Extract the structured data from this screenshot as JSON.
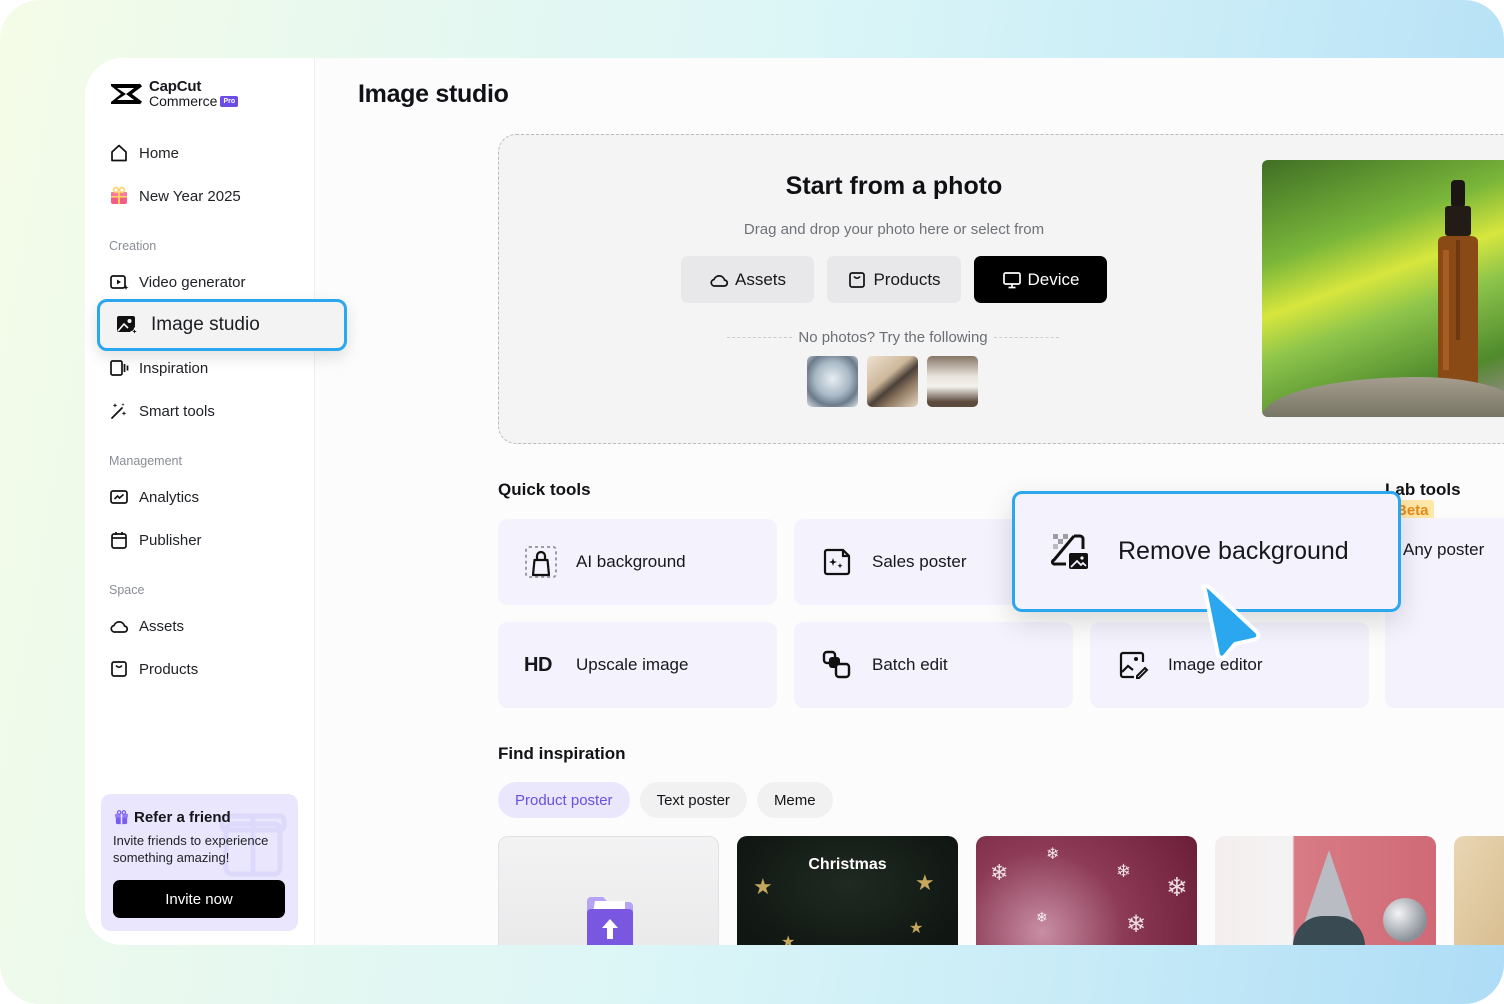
{
  "brand": {
    "name_top": "CapCut",
    "name_bottom": "Commerce",
    "badge": "Pro"
  },
  "sidebar": {
    "top_items": [
      {
        "label": "Home",
        "icon": "home-icon"
      },
      {
        "label": "New Year 2025",
        "icon": "gift-icon"
      }
    ],
    "sections": [
      {
        "label": "Creation",
        "items": [
          {
            "label": "Video generator",
            "icon": "video-sparkle-icon"
          },
          {
            "label": "Image studio",
            "icon": "image-sparkle-icon",
            "active": true
          },
          {
            "label": "Inspiration",
            "icon": "inspiration-icon"
          },
          {
            "label": "Smart tools",
            "icon": "magic-wand-icon"
          }
        ]
      },
      {
        "label": "Management",
        "items": [
          {
            "label": "Analytics",
            "icon": "chart-icon"
          },
          {
            "label": "Publisher",
            "icon": "calendar-icon"
          }
        ]
      },
      {
        "label": "Space",
        "items": [
          {
            "label": "Assets",
            "icon": "cloud-icon"
          },
          {
            "label": "Products",
            "icon": "bag-icon"
          }
        ]
      }
    ],
    "refer": {
      "title": "Refer a friend",
      "description": "Invite friends to experience something amazing!",
      "button": "Invite now"
    }
  },
  "main": {
    "title": "Image studio",
    "upload": {
      "title": "Start from a photo",
      "subtitle": "Drag and drop your photo here or select from",
      "buttons": [
        {
          "label": "Assets",
          "icon": "cloud-icon"
        },
        {
          "label": "Products",
          "icon": "bag-icon"
        },
        {
          "label": "Device",
          "icon": "monitor-icon",
          "primary": true
        }
      ],
      "try_label": "No photos? Try the following",
      "samples": [
        "earbuds",
        "eyeshadow-palette",
        "armchair"
      ]
    },
    "quick_tools": {
      "heading": "Quick tools",
      "items": [
        {
          "label": "AI background",
          "icon": "ai-background-icon"
        },
        {
          "label": "Sales poster",
          "icon": "sales-poster-icon"
        },
        {
          "label": "Remove background",
          "icon": "remove-background-icon",
          "highlighted": true
        },
        {
          "label": "Upscale image",
          "icon": "hd-icon",
          "icon_text": "HD"
        },
        {
          "label": "Batch edit",
          "icon": "batch-edit-icon"
        },
        {
          "label": "Image editor",
          "icon": "image-editor-icon"
        }
      ]
    },
    "lab_tools": {
      "heading": "Lab tools",
      "badge": "Beta",
      "items": [
        {
          "label": "Any poster"
        }
      ]
    },
    "inspiration": {
      "heading": "Find inspiration",
      "tabs": [
        {
          "label": "Product poster",
          "active": true
        },
        {
          "label": "Text poster"
        },
        {
          "label": "Meme"
        }
      ],
      "cards": [
        {
          "type": "upload"
        },
        {
          "type": "template",
          "caption": "Christmas"
        },
        {
          "type": "template"
        },
        {
          "type": "template"
        },
        {
          "type": "template"
        }
      ]
    }
  },
  "colors": {
    "accent_highlight": "#2aa7ef",
    "brand_purple": "#6b4de6",
    "beta_bg": "#ffe7a8",
    "beta_text": "#e38a1a"
  }
}
